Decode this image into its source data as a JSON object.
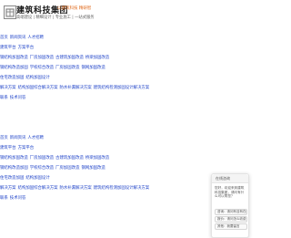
{
  "header": {
    "brand": "建筑科技集团",
    "brand_tag": "以建筑科技 精研智",
    "slogan": "高端建设 | 精细设计 | 专业施工 | 一站式服务"
  },
  "links_a": [
    [
      "首页",
      "新闻资讯",
      "人才招聘"
    ],
    [
      "建筑平台",
      "方案平台"
    ],
    [
      "钢结构加固改造",
      "厂房加固改造",
      "古建筑加固改造",
      "桥梁加固改造"
    ],
    [
      "钢结构改造加固",
      "学校综合改造",
      "厂房加固改造",
      "钢网加固改造"
    ],
    [
      "住宅改造加固",
      "结构加固设计"
    ],
    [
      "解决方案",
      "结构加固综合解决方案",
      "防水补漏解决方案",
      "建筑结构检测加固设计解决方案"
    ],
    [
      "联系",
      "技术问答"
    ]
  ],
  "links_b": [
    [
      "首页",
      "新闻资讯",
      "人才招聘"
    ],
    [
      "建筑平台",
      "方案平台"
    ],
    [
      "钢结构加固改造",
      "厂房加固改造",
      "古建筑加固改造",
      "桥梁加固改造"
    ],
    [
      "钢结构改造加固",
      "学校综合改造",
      "厂房加固改造",
      "钢网加固改造"
    ],
    [
      "住宅改造加固",
      "结构加固设计"
    ],
    [
      "解决方案",
      "结构加固综合解决方案",
      "防水补漏解决方案",
      "建筑结构检测加固设计解决方案"
    ],
    [
      "联系",
      "技术问答"
    ]
  ],
  "chat": {
    "title": "在线咨询",
    "message": "您好，欢迎来到建筑科技集团，请问有什么可以帮您？",
    "options": [
      "咨询：请问有没有在线",
      "报价：请问怎么收费",
      "其他：我要留言"
    ]
  }
}
